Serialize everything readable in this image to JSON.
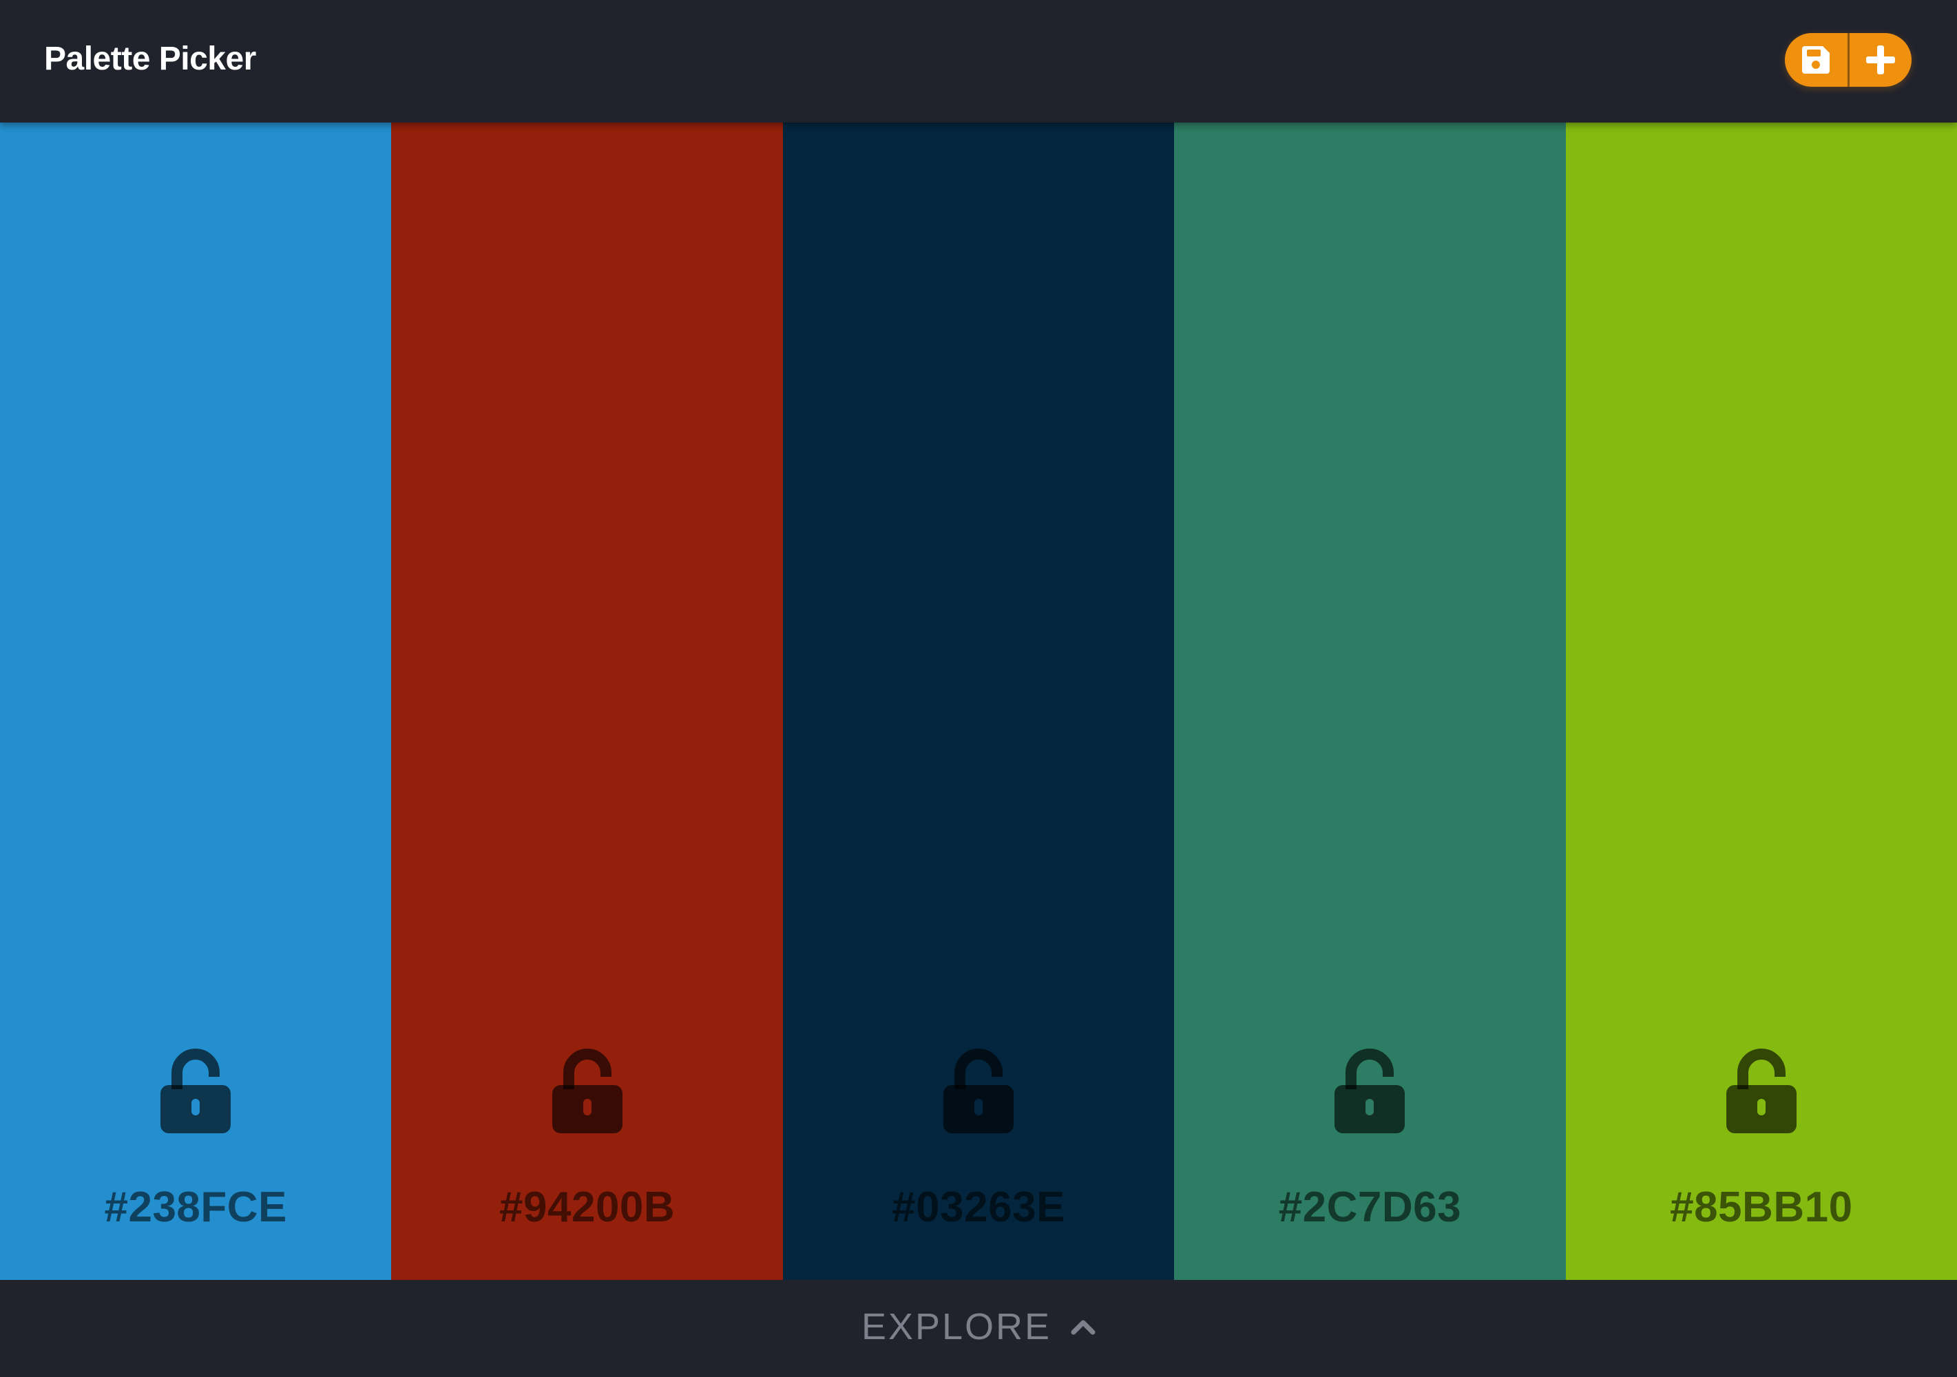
{
  "app": {
    "title": "Palette Picker"
  },
  "actions": {
    "save_icon": "floppy-disk-icon",
    "add_icon": "plus-icon",
    "accent_color": "#F0900F"
  },
  "palette": [
    {
      "hex": "#238FCE",
      "color": "#238FCE",
      "locked": false,
      "lock_icon": "unlock-icon"
    },
    {
      "hex": "#94200B",
      "color": "#94200B",
      "locked": false,
      "lock_icon": "unlock-icon"
    },
    {
      "hex": "#03263E",
      "color": "#03263E",
      "locked": false,
      "lock_icon": "unlock-icon"
    },
    {
      "hex": "#2C7D63",
      "color": "#2C7D63",
      "locked": false,
      "lock_icon": "unlock-icon"
    },
    {
      "hex": "#85BB10",
      "color": "#85BB10",
      "locked": false,
      "lock_icon": "unlock-icon"
    }
  ],
  "footer": {
    "explore_label": "EXPLORE",
    "explore_icon": "chevron-up-icon"
  }
}
